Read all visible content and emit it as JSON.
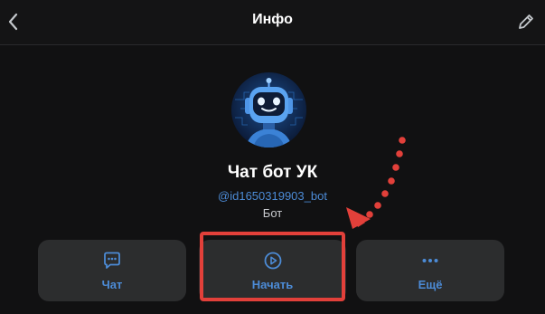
{
  "header": {
    "title": "Инфо",
    "back_icon": "chevron-left-icon",
    "edit_icon": "pencil-icon"
  },
  "profile": {
    "name": "Чат бот УК",
    "handle": "@id1650319903_bot",
    "type": "Бот",
    "avatar": "robot-avatar"
  },
  "actions": [
    {
      "label": "Чат",
      "icon": "chat-bubble-icon"
    },
    {
      "label": "Начать",
      "icon": "play-circle-icon"
    },
    {
      "label": "Ещё",
      "icon": "more-dots-icon"
    }
  ],
  "colors": {
    "accent": "#4c8bd6",
    "background": "#111112",
    "button": "#2c2d2e",
    "annotation": "#e2403a"
  }
}
